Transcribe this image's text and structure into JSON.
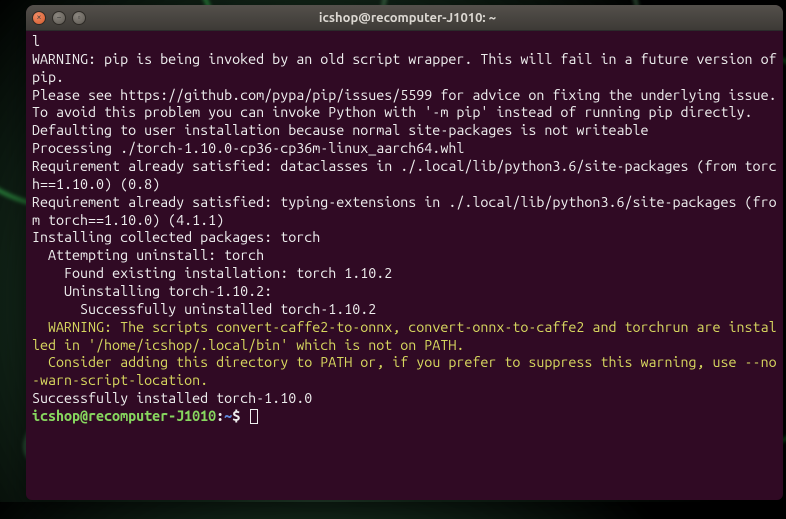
{
  "titlebar": {
    "title": "icshop@recomputer-J1010: ~"
  },
  "terminal": {
    "lines": {
      "l0": "l",
      "l1": "WARNING: pip is being invoked by an old script wrapper. This will fail in a future version of pip.",
      "l2": "Please see https://github.com/pypa/pip/issues/5599 for advice on fixing the underlying issue.",
      "l3": "To avoid this problem you can invoke Python with '-m pip' instead of running pip directly.",
      "l4": "Defaulting to user installation because normal site-packages is not writeable",
      "l5": "Processing ./torch-1.10.0-cp36-cp36m-linux_aarch64.whl",
      "l6": "Requirement already satisfied: dataclasses in ./.local/lib/python3.6/site-packages (from torch==1.10.0) (0.8)",
      "l7": "Requirement already satisfied: typing-extensions in ./.local/lib/python3.6/site-packages (from torch==1.10.0) (4.1.1)",
      "l8": "Installing collected packages: torch",
      "l9": "  Attempting uninstall: torch",
      "l10": "    Found existing installation: torch 1.10.2",
      "l11": "    Uninstalling torch-1.10.2:",
      "l12": "      Successfully uninstalled torch-1.10.2",
      "l13": "  WARNING: The scripts convert-caffe2-to-onnx, convert-onnx-to-caffe2 and torchrun are installed in '/home/icshop/.local/bin' which is not on PATH.",
      "l14": "  Consider adding this directory to PATH or, if you prefer to suppress this warning, use --no-warn-script-location.",
      "l15": "Successfully installed torch-1.10.0"
    },
    "prompt": {
      "user_host": "icshop@recomputer-J1010",
      "colon": ":",
      "path": "~",
      "symbol": "$ "
    }
  }
}
